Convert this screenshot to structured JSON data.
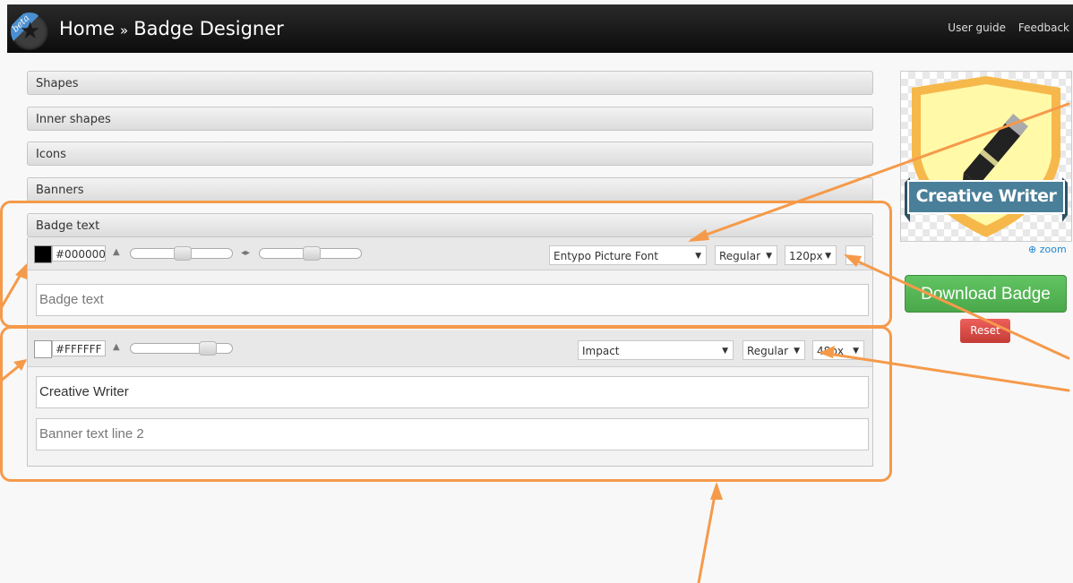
{
  "header": {
    "beta_label": "beta",
    "home": "Home",
    "separator": "»",
    "page": "Badge Designer",
    "links": [
      "User guide",
      "Feedback"
    ]
  },
  "accordion": {
    "shapes": "Shapes",
    "inner_shapes": "Inner shapes",
    "icons": "Icons",
    "banners": "Banners",
    "badge_text": "Badge text"
  },
  "badge_text_panel": {
    "color_hex": "#000000",
    "color_swatch": "#000000",
    "font": "Entypo Picture Font",
    "style": "Regular",
    "size": "120px",
    "text_placeholder": "Badge text"
  },
  "banner_text_panel": {
    "color_hex": "#FFFFFF",
    "color_swatch": "#FFFFFF",
    "font": "Impact",
    "style": "Regular",
    "size": "48px",
    "line1_value": "Creative Writer",
    "line2_placeholder": "Banner text line 2"
  },
  "preview": {
    "banner_text": "Creative Writer",
    "zoom_label": "zoom"
  },
  "buttons": {
    "download": "Download Badge",
    "reset": "Reset"
  },
  "colors": {
    "accent_annotation": "#f59a4a",
    "download_green": "#5cb85c",
    "reset_red": "#d9534f",
    "banner_blue": "#4a7f99",
    "shield_fill": "#fff9a8",
    "shield_border": "#f6b84a"
  }
}
